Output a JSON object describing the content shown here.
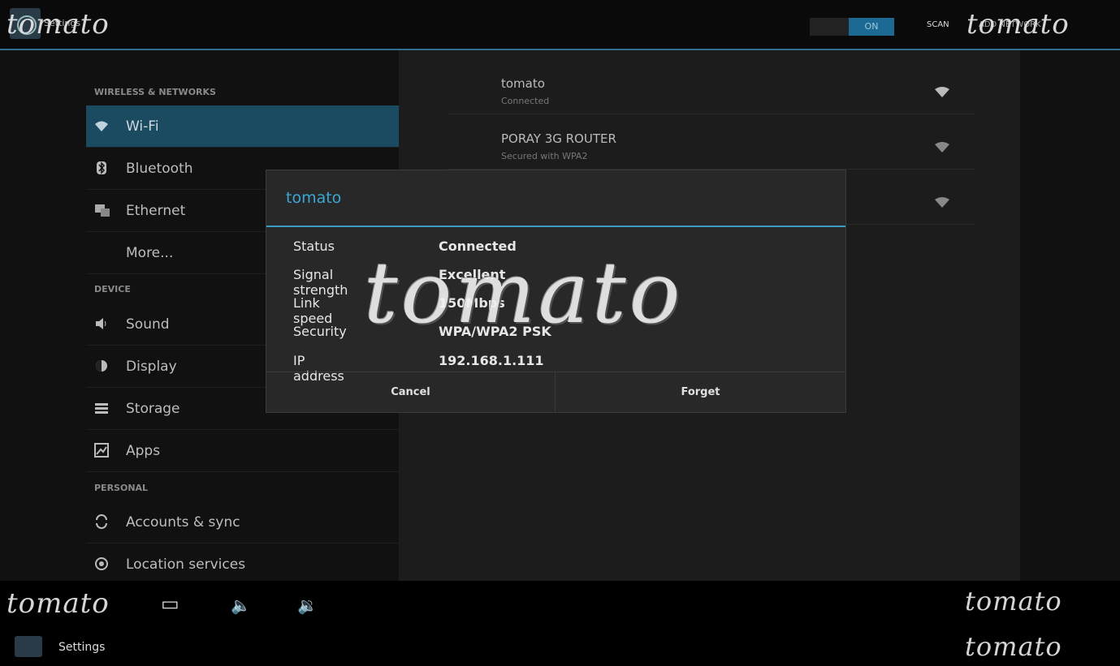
{
  "actionbar": {
    "app_title": "Settings",
    "wifi_toggle": "ON",
    "scan": "SCAN",
    "add_network": "ADD NETWORK"
  },
  "watermark": "tomato",
  "sidebar": {
    "sections": [
      {
        "header": "WIRELESS & NETWORKS"
      },
      {
        "header": "DEVICE"
      },
      {
        "header": "PERSONAL"
      }
    ],
    "items": [
      {
        "label": "Wi-Fi",
        "icon": "wifi-icon"
      },
      {
        "label": "Bluetooth",
        "icon": "bluetooth-icon"
      },
      {
        "label": "Ethernet",
        "icon": "ethernet-icon"
      },
      {
        "label": "More..."
      },
      {
        "label": "Sound",
        "icon": "speaker-icon"
      },
      {
        "label": "Display",
        "icon": "display-icon"
      },
      {
        "label": "Storage",
        "icon": "storage-icon"
      },
      {
        "label": "Apps",
        "icon": "apps-icon"
      },
      {
        "label": "Accounts & sync",
        "icon": "sync-icon"
      },
      {
        "label": "Location services",
        "icon": "location-icon"
      }
    ]
  },
  "networks": [
    {
      "ssid": "tomato",
      "status": "Connected"
    },
    {
      "ssid": "PORAY 3G ROUTER",
      "status": "Secured with WPA2"
    },
    {
      "ssid": "",
      "status": ""
    }
  ],
  "dialog": {
    "title": "tomato",
    "rows": [
      {
        "key": "Status",
        "value": "Connected"
      },
      {
        "key": "Signal strength",
        "value": "Excellent"
      },
      {
        "key": "Link speed",
        "value": "150Mbps"
      },
      {
        "key": "Security",
        "value": "WPA/WPA2 PSK"
      },
      {
        "key": "IP address",
        "value": "192.168.1.111"
      }
    ],
    "cancel": "Cancel",
    "forget": "Forget"
  },
  "bottom": {
    "settings_label": "Settings"
  },
  "colors": {
    "accent": "#3aa7d6",
    "selected": "#1b4b60"
  }
}
